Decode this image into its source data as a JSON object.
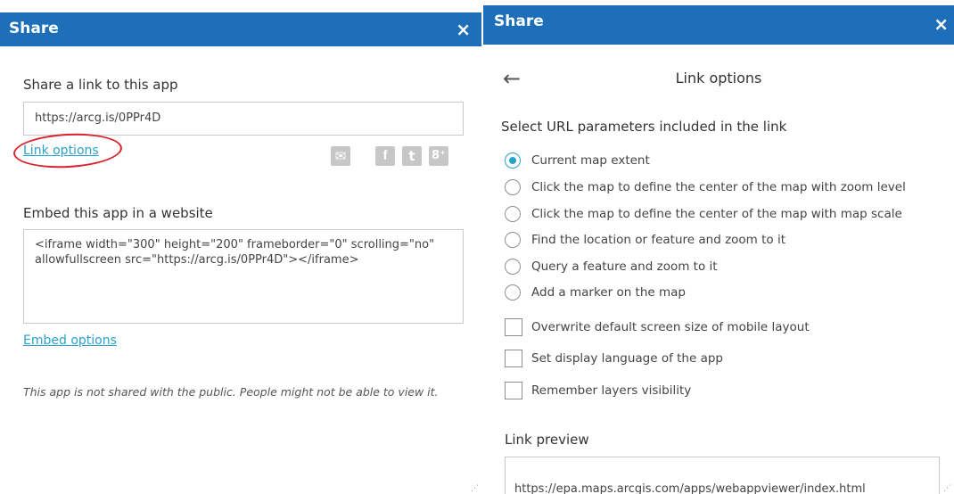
{
  "left": {
    "title": "Share",
    "close": "×",
    "share_label": "Share a link to this app",
    "link_value": "https://arcg.is/0PPr4D",
    "link_options": "Link options",
    "social": {
      "mail": "✉",
      "facebook": "f",
      "twitter": "t",
      "gplus": "8⁺"
    },
    "embed_label": "Embed this app in a website",
    "embed_code": "<iframe width=\"300\" height=\"200\" frameborder=\"0\" scrolling=\"no\" allowfullscreen src=\"https://arcg.is/0PPr4D\"></iframe>",
    "embed_options": "Embed options",
    "notice": "This app is not shared with the public. People might not be able to view it.",
    "annotation_color": "#d9232e"
  },
  "right": {
    "title": "Share",
    "close": "×",
    "back": "←",
    "heading": "Link options",
    "section_label": "Select URL parameters included in the link",
    "radios": [
      {
        "label": "Current map extent",
        "selected": true
      },
      {
        "label": "Click the map to define the center of the map with zoom level",
        "selected": false
      },
      {
        "label": "Click the map to define the center of the map with map scale",
        "selected": false
      },
      {
        "label": "Find the location or feature and zoom to it",
        "selected": false
      },
      {
        "label": "Query a feature and zoom to it",
        "selected": false
      },
      {
        "label": "Add a marker on the map",
        "selected": false
      }
    ],
    "checkboxes": [
      {
        "label": "Overwrite default screen size of mobile layout",
        "checked": false
      },
      {
        "label": "Set display language of the app",
        "checked": false
      },
      {
        "label": "Remember layers visibility",
        "checked": false
      }
    ],
    "preview_label": "Link preview",
    "preview_value": "https://epa.maps.arcgis.com/apps/webappviewer/index.html\n?"
  },
  "colors": {
    "header": "#1c6fb8",
    "accent": "#2aa1c9",
    "social_gray": "#c7c7c7"
  }
}
